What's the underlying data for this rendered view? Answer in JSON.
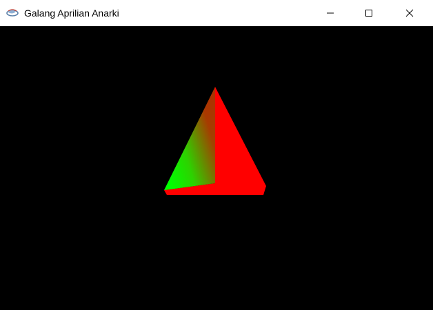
{
  "window": {
    "title": "Galang Aprilian Anarki",
    "app_icon": "java-cup-icon",
    "controls": {
      "minimize_icon": "minimize-icon",
      "maximize_icon": "maximize-icon",
      "close_icon": "close-icon"
    }
  },
  "scene": {
    "background": "#000000",
    "shape": "pyramid",
    "colors": {
      "apex": "#ff0000",
      "left_face_edge": "#00ff00",
      "front_face": "#ff0000"
    }
  }
}
